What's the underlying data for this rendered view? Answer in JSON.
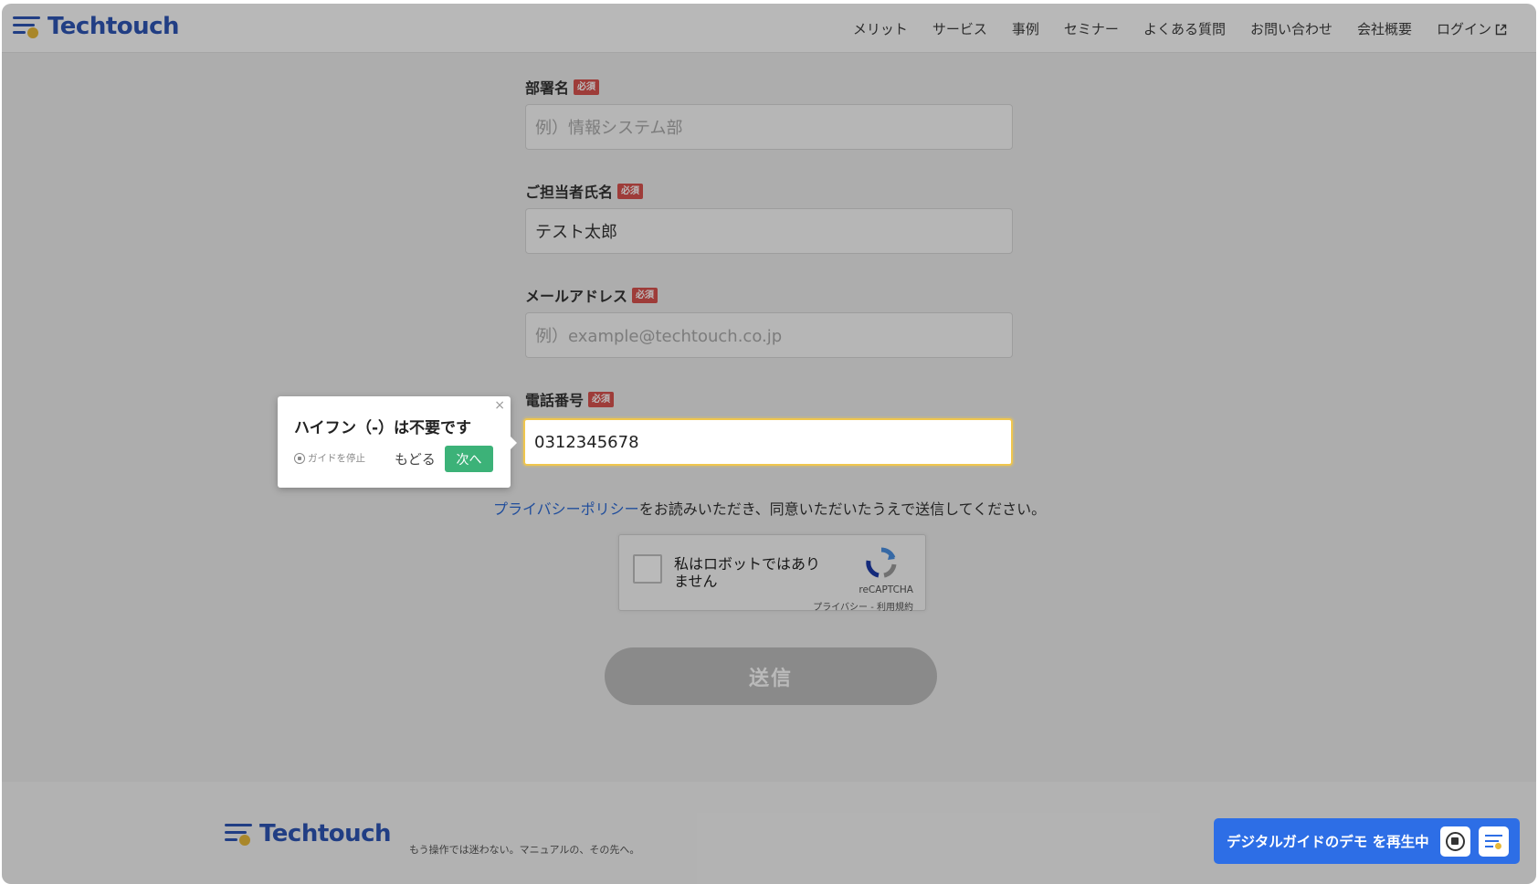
{
  "brand": {
    "name": "Techtouch",
    "tagline": "もう操作では迷わない。マニュアルの、その先へ。"
  },
  "nav": {
    "items": [
      "メリット",
      "サービス",
      "事例",
      "セミナー",
      "よくある質問",
      "お問い合わせ",
      "会社概要"
    ],
    "login": "ログイン"
  },
  "form": {
    "required_badge": "必須",
    "department": {
      "label": "部署名",
      "placeholder": "例）情報システム部",
      "value": ""
    },
    "contact_name": {
      "label": "ご担当者氏名",
      "value": "テスト太郎"
    },
    "email": {
      "label": "メールアドレス",
      "placeholder": "例）example@techtouch.co.jp",
      "value": ""
    },
    "phone": {
      "label": "電話番号",
      "value": "0312345678"
    },
    "privacy_link": "プライバシーポリシー",
    "privacy_text": "をお読みいただき、同意いただいたうえで送信してください。",
    "submit": "送信"
  },
  "recaptcha": {
    "label": "私はロボットではありません",
    "brand": "reCAPTCHA",
    "links": "プライバシー - 利用規約"
  },
  "guide_tooltip": {
    "title": "ハイフン（-）は不要です",
    "stop": "ガイドを停止",
    "back": "もどる",
    "next": "次へ",
    "close": "×"
  },
  "demo_banner": {
    "text": "デジタルガイドのデモ を再生中"
  },
  "colors": {
    "brand": "#2e56b5",
    "accent_dot": "#e8b93a",
    "required": "#d9534f",
    "next_button": "#3cb278",
    "demo_banner": "#2d6ee6",
    "focus": "#f0c64d"
  }
}
